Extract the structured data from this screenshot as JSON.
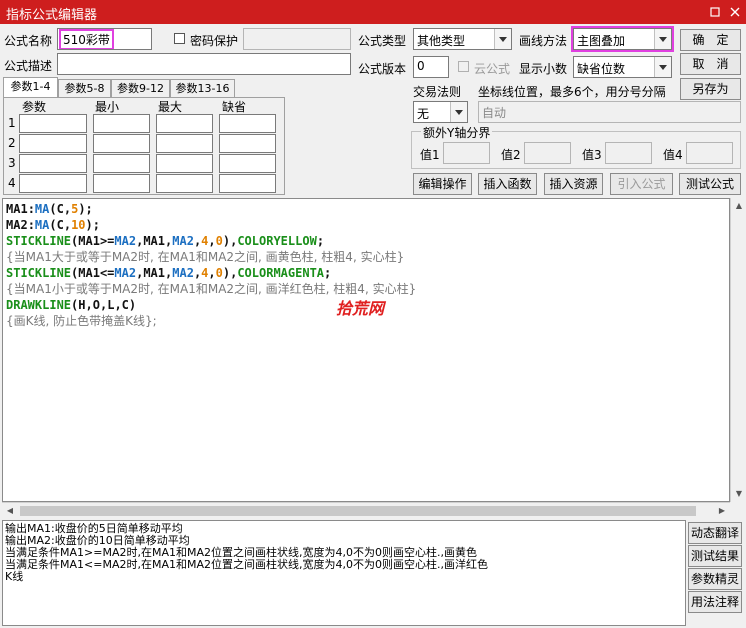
{
  "window": {
    "title": "指标公式编辑器",
    "restore_icon": "restore-icon",
    "close_icon": "close-icon"
  },
  "form": {
    "name_label": "公式名称",
    "name_value": "510彩带",
    "password_label": "密码保护",
    "password_value": "",
    "type_label": "公式类型",
    "type_value": "其他类型",
    "draw_label": "画线方法",
    "draw_value": "主图叠加",
    "confirm_label": "确　定",
    "desc_label": "公式描述",
    "desc_value": "",
    "version_label": "公式版本",
    "version_value": "0",
    "cloud_label": "云公式",
    "decimals_label": "显示小数",
    "decimals_value": "缺省位数",
    "cancel_label": "取　消",
    "trade_label": "交易法则",
    "coord_label": "坐标线位置，最多6个，用分号分隔",
    "save_as_label": "另存为",
    "trade_value": "无",
    "coord_value": "自动",
    "yaxis_label": "额外Y轴分界",
    "yaxis_values": [
      "值1",
      "值2",
      "值3",
      "值4"
    ]
  },
  "tabs": [
    "参数1-4",
    "参数5-8",
    "参数9-12",
    "参数13-16"
  ],
  "params": {
    "headers": [
      "参数",
      "最小",
      "最大",
      "缺省"
    ],
    "rows": [
      "1",
      "2",
      "3",
      "4"
    ]
  },
  "toolbar": {
    "edit": "编辑操作",
    "insert_func": "插入函数",
    "insert_res": "插入资源",
    "import_formula": "引入公式",
    "test_formula": "测试公式"
  },
  "code": {
    "line1": [
      [
        "var",
        "MA1"
      ],
      [
        "sym",
        ":"
      ],
      [
        "kw",
        "MA"
      ],
      [
        "sym",
        "("
      ],
      [
        "var",
        "C"
      ],
      [
        "sym",
        ","
      ],
      [
        "num",
        "5"
      ],
      [
        "sym",
        ");"
      ]
    ],
    "line2": [
      [
        "var",
        "MA2"
      ],
      [
        "sym",
        ":"
      ],
      [
        "kw",
        "MA"
      ],
      [
        "sym",
        "("
      ],
      [
        "var",
        "C"
      ],
      [
        "sym",
        ","
      ],
      [
        "num",
        "10"
      ],
      [
        "sym",
        ");"
      ]
    ],
    "line3": [
      [
        "fn",
        "STICKLINE"
      ],
      [
        "sym",
        "("
      ],
      [
        "var",
        "MA1"
      ],
      [
        "sym",
        ">="
      ],
      [
        "kw",
        "MA2"
      ],
      [
        "sym",
        ","
      ],
      [
        "var",
        "MA1"
      ],
      [
        "sym",
        ","
      ],
      [
        "kw",
        "MA2"
      ],
      [
        "sym",
        ","
      ],
      [
        "num",
        "4"
      ],
      [
        "sym",
        ","
      ],
      [
        "num",
        "0"
      ],
      [
        "sym",
        "),"
      ],
      [
        "fn",
        "COLORYELLOW"
      ],
      [
        "sym",
        ";"
      ]
    ],
    "line4": [
      [
        "cm",
        "{当MA1大于或等于MA2时, 在MA1和MA2之间, 画黄色柱, 柱粗4, 实心柱}"
      ]
    ],
    "line5": [
      [
        "fn",
        "STICKLINE"
      ],
      [
        "sym",
        "("
      ],
      [
        "var",
        "MA1"
      ],
      [
        "sym",
        "<="
      ],
      [
        "kw",
        "MA2"
      ],
      [
        "sym",
        ","
      ],
      [
        "var",
        "MA1"
      ],
      [
        "sym",
        ","
      ],
      [
        "kw",
        "MA2"
      ],
      [
        "sym",
        ","
      ],
      [
        "num",
        "4"
      ],
      [
        "sym",
        ","
      ],
      [
        "num",
        "0"
      ],
      [
        "sym",
        "),"
      ],
      [
        "fn",
        "COLORMAGENTA"
      ],
      [
        "sym",
        ";"
      ]
    ],
    "line6": [
      [
        "cm",
        "{当MA1小于或等于MA2时, 在MA1和MA2之间, 画洋红色柱, 柱粗4, 实心柱}"
      ]
    ],
    "line7": [
      [
        "fn",
        "DRAWKLINE"
      ],
      [
        "sym",
        "("
      ],
      [
        "var",
        "H"
      ],
      [
        "sym",
        ","
      ],
      [
        "var",
        "O"
      ],
      [
        "sym",
        ","
      ],
      [
        "var",
        "L"
      ],
      [
        "sym",
        ","
      ],
      [
        "var",
        "C"
      ],
      [
        "sym",
        ")"
      ]
    ],
    "line8": [
      [
        "cm",
        "{画K线, 防止色带掩盖K线};"
      ]
    ],
    "watermark": "拾荒网"
  },
  "output": {
    "lines": [
      "输出MA1:收盘价的5日简单移动平均",
      "输出MA2:收盘价的10日简单移动平均",
      "当满足条件MA1>=MA2时,在MA1和MA2位置之间画柱状线,宽度为4,0不为0则画空心柱.,画黄色",
      "当满足条件MA1<=MA2时,在MA1和MA2位置之间画柱状线,宽度为4,0不为0则画空心柱.,画洋红色",
      "K线"
    ]
  },
  "side_buttons": {
    "translate": "动态翻译",
    "test_result": "测试结果",
    "param_wizard": "参数精灵",
    "usage_notes": "用法注释"
  }
}
